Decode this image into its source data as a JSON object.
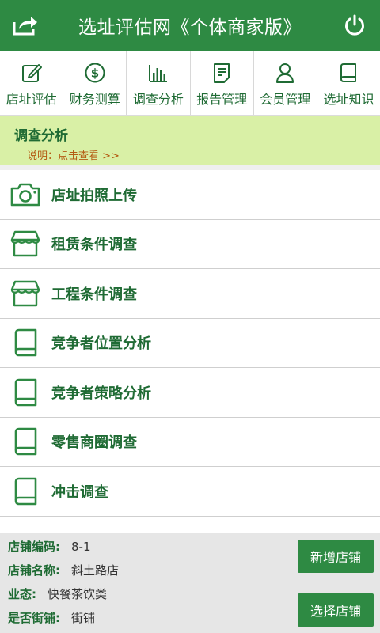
{
  "header": {
    "title": "选址评估网《个体商家版》",
    "share_icon": "share-icon",
    "power_icon": "power-icon"
  },
  "nav": {
    "items": [
      {
        "label": "店址评估",
        "icon": "edit-icon"
      },
      {
        "label": "财务测算",
        "icon": "dollar-icon"
      },
      {
        "label": "调查分析",
        "icon": "bar-chart-icon"
      },
      {
        "label": "报告管理",
        "icon": "document-icon"
      },
      {
        "label": "会员管理",
        "icon": "user-icon"
      },
      {
        "label": "选址知识",
        "icon": "book-icon"
      }
    ]
  },
  "banner": {
    "title": "调查分析",
    "desc_label": "说明：",
    "desc_link": "点击查看 >>"
  },
  "list": {
    "items": [
      {
        "label": "店址拍照上传",
        "icon": "camera-icon"
      },
      {
        "label": "租赁条件调查",
        "icon": "storefront-icon"
      },
      {
        "label": "工程条件调查",
        "icon": "storefront-icon"
      },
      {
        "label": "竞争者位置分析",
        "icon": "book-icon"
      },
      {
        "label": "竞争者策略分析",
        "icon": "book-icon"
      },
      {
        "label": "零售商圈调查",
        "icon": "book-icon"
      },
      {
        "label": "冲击调查",
        "icon": "book-icon"
      }
    ]
  },
  "footer": {
    "store_code_label": "店铺编码:",
    "store_code": "8-1",
    "store_name_label": "店铺名称:",
    "store_name": "斜土路店",
    "business_type_label": "业态:",
    "business_type": "快餐茶饮类",
    "street_shop_label": "是否街铺:",
    "street_shop": "街铺",
    "add_store_button": "新增店铺",
    "select_store_button": "选择店铺"
  },
  "colors": {
    "primary": "#2e8a43",
    "text_green": "#1f6b34",
    "banner_bg": "#d9f0a6",
    "link_orange": "#b45a12",
    "footer_bg": "#e6e6e6"
  }
}
